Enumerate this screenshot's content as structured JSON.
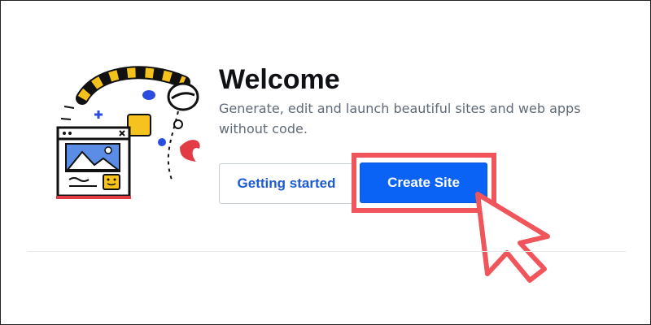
{
  "welcome": {
    "title": "Welcome",
    "subtitle": "Generate, edit and launch beautiful sites and web apps without code."
  },
  "actions": {
    "getting_started_label": "Getting started",
    "create_site_label": "Create Site"
  },
  "colors": {
    "primary": "#0b63f6",
    "highlight": "#f0555b",
    "link": "#1c5bd3"
  },
  "icons": {
    "illustration": "website-builder-illustration",
    "pointer": "cursor-arrow-icon"
  }
}
